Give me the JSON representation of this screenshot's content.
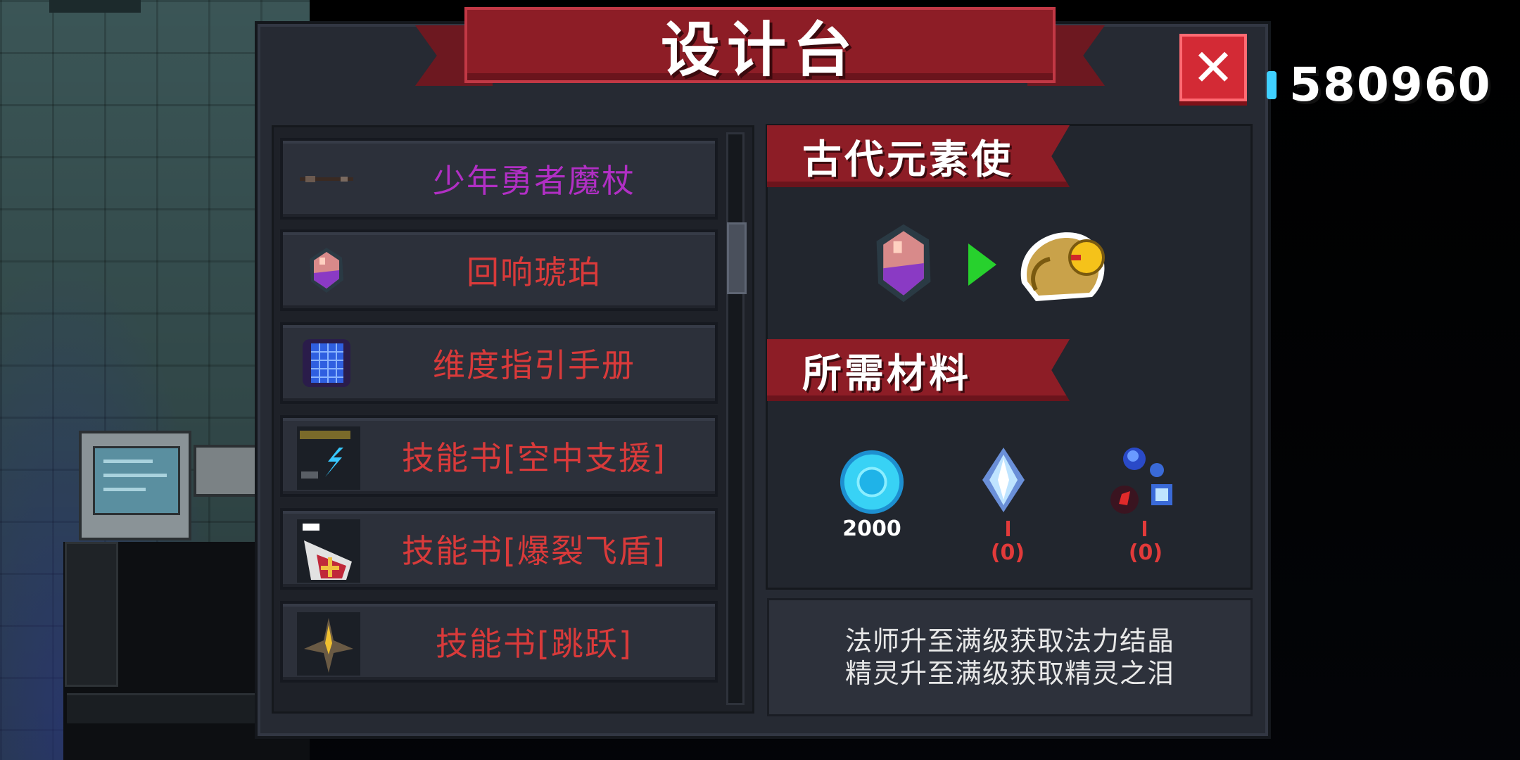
{
  "title": "设计台",
  "close_icon": "close-x-icon",
  "currency": {
    "icon": "gem-icon",
    "value": "580960"
  },
  "recipes": [
    {
      "name": "少年勇者魔杖",
      "icon": "wand-icon",
      "color": "#b12fc4"
    },
    {
      "name": "回响琥珀",
      "icon": "amber-gem-icon",
      "color": "#d93a3a"
    },
    {
      "name": "维度指引手册",
      "icon": "manual-icon",
      "color": "#d93a3a"
    },
    {
      "name": "技能书[空中支援]",
      "icon": "air-support-book-icon",
      "color": "#d93a3a"
    },
    {
      "name": "技能书[爆裂飞盾]",
      "icon": "shield-book-icon",
      "color": "#d93a3a"
    },
    {
      "name": "技能书[跳跃]",
      "icon": "jump-book-icon",
      "color": "#d93a3a"
    }
  ],
  "detail": {
    "result_label": "古代元素使",
    "materials_label": "所需材料",
    "materials": [
      {
        "icon": "blue-coin-icon",
        "count": "2000",
        "color": "#ffffff"
      },
      {
        "icon": "mana-crystal-icon",
        "count": "(0)",
        "color": "#e23a3a"
      },
      {
        "icon": "spirit-tear-icon",
        "count": "(0)",
        "color": "#e23a3a"
      }
    ],
    "description": [
      "法师升至满级获取法力结晶",
      "精灵升至满级获取精灵之泪"
    ]
  },
  "colors": {
    "panel": "#262a33",
    "banner": "#8d1d26",
    "close": "#d32a35",
    "arrow": "#27d12d"
  }
}
